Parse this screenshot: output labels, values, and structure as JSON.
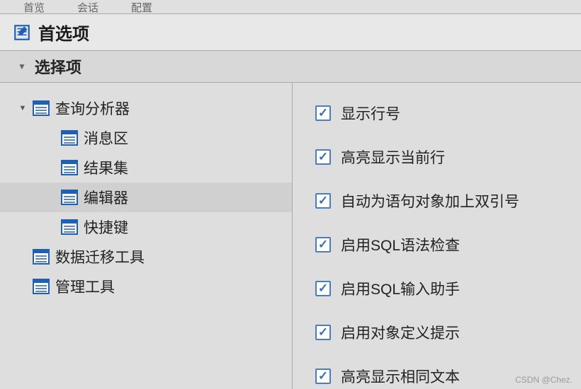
{
  "topTabs": [
    "首览",
    "会话",
    "配置"
  ],
  "header": {
    "title": "首选项"
  },
  "section": {
    "title": "选择项"
  },
  "sidebar": {
    "items": [
      {
        "label": "查询分析器",
        "level": 0,
        "expanded": true,
        "hasExpand": true,
        "selected": false
      },
      {
        "label": "消息区",
        "level": 1,
        "expanded": false,
        "hasExpand": false,
        "selected": false
      },
      {
        "label": "结果集",
        "level": 1,
        "expanded": false,
        "hasExpand": false,
        "selected": false
      },
      {
        "label": "编辑器",
        "level": 1,
        "expanded": false,
        "hasExpand": false,
        "selected": true
      },
      {
        "label": "快捷键",
        "level": 1,
        "expanded": false,
        "hasExpand": false,
        "selected": false
      },
      {
        "label": "数据迁移工具",
        "level": 0,
        "expanded": false,
        "hasExpand": false,
        "selected": false
      },
      {
        "label": "管理工具",
        "level": 0,
        "expanded": false,
        "hasExpand": false,
        "selected": false
      }
    ]
  },
  "content": {
    "checkboxes": [
      {
        "label": "显示行号",
        "checked": true
      },
      {
        "label": "高亮显示当前行",
        "checked": true
      },
      {
        "label": "自动为语句对象加上双引号",
        "checked": true
      },
      {
        "label": "启用SQL语法检查",
        "checked": true
      },
      {
        "label": "启用SQL输入助手",
        "checked": true
      },
      {
        "label": "启用对象定义提示",
        "checked": true
      },
      {
        "label": "高亮显示相同文本",
        "checked": true
      }
    ]
  },
  "watermark": "CSDN @Chez."
}
